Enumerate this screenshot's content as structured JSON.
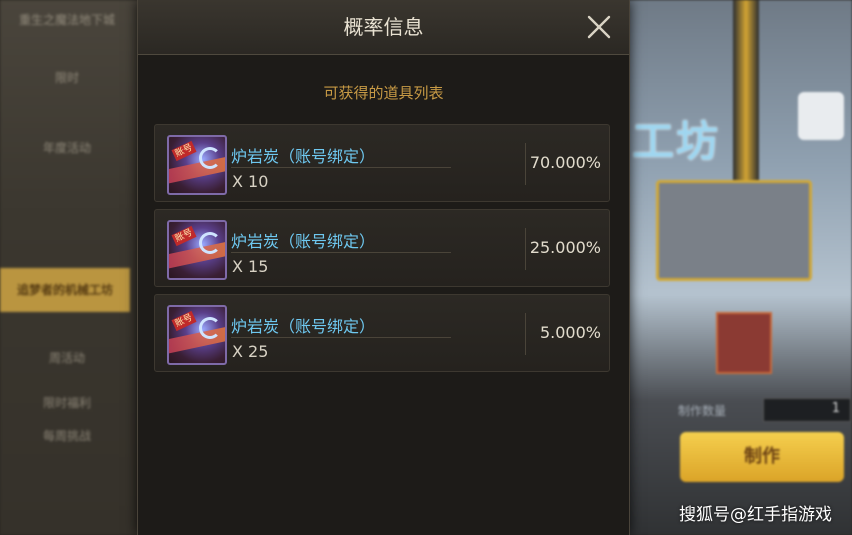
{
  "background": {
    "left_menu": [
      "重生之魔法地下城",
      "限时",
      "年度活动",
      "追梦者的机械工坊",
      "周活动",
      "限时福利",
      "每周挑战"
    ],
    "right_scene": {
      "sign_text": "工坊",
      "qty_label": "制作数量",
      "qty_value": "1",
      "make_button": "制作"
    }
  },
  "modal": {
    "title": "概率信息",
    "close_icon": "close-icon",
    "subtitle": "可获得的道具列表",
    "items": [
      {
        "icon": "lava-coal-icon",
        "bind_tag": "账号",
        "name": "炉岩炭（账号绑定）",
        "qty": "X 10",
        "prob": "70.000%"
      },
      {
        "icon": "lava-coal-icon",
        "bind_tag": "账号",
        "name": "炉岩炭（账号绑定）",
        "qty": "X 15",
        "prob": "25.000%"
      },
      {
        "icon": "lava-coal-icon",
        "bind_tag": "账号",
        "name": "炉岩炭（账号绑定）",
        "qty": "X 25",
        "prob": "5.000%"
      }
    ]
  },
  "watermark": "搜狐号@红手指游戏",
  "colors": {
    "accent_gold": "#c79a45",
    "item_name_blue": "#6ec8f0",
    "modal_bg": "#1d1b18"
  }
}
